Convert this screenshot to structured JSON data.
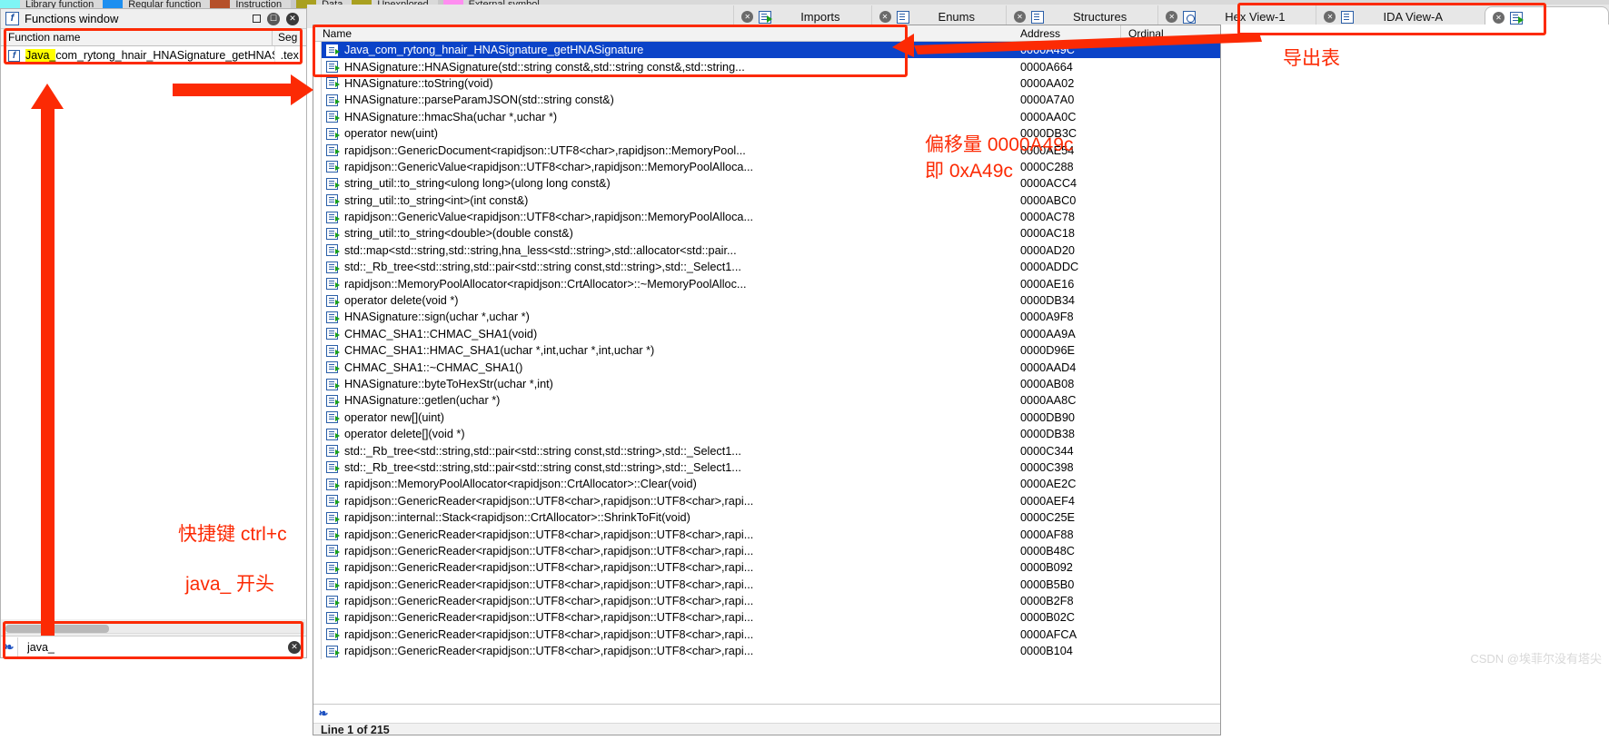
{
  "legend": {
    "entries": [
      {
        "label": "Library function",
        "color": "#7ff5f5"
      },
      {
        "label": "Regular function",
        "color": "#1d8ff0"
      },
      {
        "label": "Instruction",
        "color": "#b5502a"
      },
      {
        "label": "Data",
        "color": "#a9a020"
      },
      {
        "label": "Unexplored",
        "color": "#a9a020"
      },
      {
        "label": "External symbol",
        "color": "#ff8ef0"
      }
    ]
  },
  "functions_window": {
    "title": "Functions window",
    "icon": "function-f-icon",
    "restore_icon": "restore-icon",
    "float_icon": "float-icon",
    "close_icon": "close-icon",
    "columns": [
      "Function name",
      "Seg"
    ],
    "rows": [
      {
        "name_highlight": "Java_",
        "name_rest": "com_rytong_hnair_HNASignature_getHNASig...",
        "seg": ".tex"
      }
    ],
    "filter_value": "java_",
    "filter_placeholder": "",
    "scroll_thumb_name": "horizontal-scrollbar"
  },
  "tabs": [
    {
      "label": "IDA View-A",
      "icon": "ida-view-icon",
      "closeable": true,
      "active": false
    },
    {
      "label": "Hex View-1",
      "icon": "hex-view-icon",
      "closeable": true,
      "active": false
    },
    {
      "label": "Structures",
      "icon": "structures-icon",
      "closeable": true,
      "active": false
    },
    {
      "label": "Enums",
      "icon": "enums-icon",
      "closeable": true,
      "active": false
    },
    {
      "label": "Imports",
      "icon": "imports-icon",
      "closeable": true,
      "active": false
    },
    {
      "label": "",
      "icon": "exports-icon",
      "closeable": true,
      "active": true
    }
  ],
  "exports": {
    "columns": [
      "Name",
      "Address",
      "Ordinal"
    ],
    "status": "Line 1 of 215",
    "filter_value": "",
    "rows": [
      {
        "name": "Java_com_rytong_hnair_HNASignature_getHNASignature",
        "address": "0000A49C",
        "ordinal": "",
        "selected": true
      },
      {
        "name": "HNASignature::HNASignature(std::string const&,std::string const&,std::string...",
        "address": "0000A664",
        "ordinal": "",
        "selected": false
      },
      {
        "name": "HNASignature::toString(void)",
        "address": "0000AA02",
        "ordinal": "",
        "selected": false
      },
      {
        "name": "HNASignature::parseParamJSON(std::string const&)",
        "address": "0000A7A0",
        "ordinal": "",
        "selected": false
      },
      {
        "name": "HNASignature::hmacSha(uchar *,uchar *)",
        "address": "0000AA0C",
        "ordinal": "",
        "selected": false
      },
      {
        "name": "operator new(uint)",
        "address": "0000DB3C",
        "ordinal": "",
        "selected": false
      },
      {
        "name": "rapidjson::GenericDocument<rapidjson::UTF8<char>,rapidjson::MemoryPool...",
        "address": "0000AE54",
        "ordinal": "",
        "selected": false
      },
      {
        "name": "rapidjson::GenericValue<rapidjson::UTF8<char>,rapidjson::MemoryPoolAlloca...",
        "address": "0000C288",
        "ordinal": "",
        "selected": false
      },
      {
        "name": "string_util::to_string<ulong long>(ulong long const&)",
        "address": "0000ACC4",
        "ordinal": "",
        "selected": false
      },
      {
        "name": "string_util::to_string<int>(int const&)",
        "address": "0000ABC0",
        "ordinal": "",
        "selected": false
      },
      {
        "name": "rapidjson::GenericValue<rapidjson::UTF8<char>,rapidjson::MemoryPoolAlloca...",
        "address": "0000AC78",
        "ordinal": "",
        "selected": false
      },
      {
        "name": "string_util::to_string<double>(double const&)",
        "address": "0000AC18",
        "ordinal": "",
        "selected": false
      },
      {
        "name": "std::map<std::string,std::string,hna_less<std::string>,std::allocator<std::pair...",
        "address": "0000AD20",
        "ordinal": "",
        "selected": false
      },
      {
        "name": "std::_Rb_tree<std::string,std::pair<std::string const,std::string>,std::_Select1...",
        "address": "0000ADDC",
        "ordinal": "",
        "selected": false
      },
      {
        "name": "rapidjson::MemoryPoolAllocator<rapidjson::CrtAllocator>::~MemoryPoolAlloc...",
        "address": "0000AE16",
        "ordinal": "",
        "selected": false
      },
      {
        "name": "operator delete(void *)",
        "address": "0000DB34",
        "ordinal": "",
        "selected": false
      },
      {
        "name": "HNASignature::sign(uchar *,uchar *)",
        "address": "0000A9F8",
        "ordinal": "",
        "selected": false
      },
      {
        "name": "CHMAC_SHA1::CHMAC_SHA1(void)",
        "address": "0000AA9A",
        "ordinal": "",
        "selected": false
      },
      {
        "name": "CHMAC_SHA1::HMAC_SHA1(uchar *,int,uchar *,int,uchar *)",
        "address": "0000D96E",
        "ordinal": "",
        "selected": false
      },
      {
        "name": "CHMAC_SHA1::~CHMAC_SHA1()",
        "address": "0000AAD4",
        "ordinal": "",
        "selected": false
      },
      {
        "name": "HNASignature::byteToHexStr(uchar *,int)",
        "address": "0000AB08",
        "ordinal": "",
        "selected": false
      },
      {
        "name": "HNASignature::getlen(uchar *)",
        "address": "0000AA8C",
        "ordinal": "",
        "selected": false
      },
      {
        "name": "operator new[](uint)",
        "address": "0000DB90",
        "ordinal": "",
        "selected": false
      },
      {
        "name": "operator delete[](void *)",
        "address": "0000DB38",
        "ordinal": "",
        "selected": false
      },
      {
        "name": "std::_Rb_tree<std::string,std::pair<std::string const,std::string>,std::_Select1...",
        "address": "0000C344",
        "ordinal": "",
        "selected": false
      },
      {
        "name": "std::_Rb_tree<std::string,std::pair<std::string const,std::string>,std::_Select1...",
        "address": "0000C398",
        "ordinal": "",
        "selected": false
      },
      {
        "name": "rapidjson::MemoryPoolAllocator<rapidjson::CrtAllocator>::Clear(void)",
        "address": "0000AE2C",
        "ordinal": "",
        "selected": false
      },
      {
        "name": "rapidjson::GenericReader<rapidjson::UTF8<char>,rapidjson::UTF8<char>,rapi...",
        "address": "0000AEF4",
        "ordinal": "",
        "selected": false
      },
      {
        "name": "rapidjson::internal::Stack<rapidjson::CrtAllocator>::ShrinkToFit(void)",
        "address": "0000C25E",
        "ordinal": "",
        "selected": false
      },
      {
        "name": "rapidjson::GenericReader<rapidjson::UTF8<char>,rapidjson::UTF8<char>,rapi...",
        "address": "0000AF88",
        "ordinal": "",
        "selected": false
      },
      {
        "name": "rapidjson::GenericReader<rapidjson::UTF8<char>,rapidjson::UTF8<char>,rapi...",
        "address": "0000B48C",
        "ordinal": "",
        "selected": false
      },
      {
        "name": "rapidjson::GenericReader<rapidjson::UTF8<char>,rapidjson::UTF8<char>,rapi...",
        "address": "0000B092",
        "ordinal": "",
        "selected": false
      },
      {
        "name": "rapidjson::GenericReader<rapidjson::UTF8<char>,rapidjson::UTF8<char>,rapi...",
        "address": "0000B5B0",
        "ordinal": "",
        "selected": false
      },
      {
        "name": "rapidjson::GenericReader<rapidjson::UTF8<char>,rapidjson::UTF8<char>,rapi...",
        "address": "0000B2F8",
        "ordinal": "",
        "selected": false
      },
      {
        "name": "rapidjson::GenericReader<rapidjson::UTF8<char>,rapidjson::UTF8<char>,rapi...",
        "address": "0000B02C",
        "ordinal": "",
        "selected": false
      },
      {
        "name": "rapidjson::GenericReader<rapidjson::UTF8<char>,rapidjson::UTF8<char>,rapi...",
        "address": "0000AFCA",
        "ordinal": "",
        "selected": false
      },
      {
        "name": "rapidjson::GenericReader<rapidjson::UTF8<char>,rapidjson::UTF8<char>,rapi...",
        "address": "0000B104",
        "ordinal": "",
        "selected": false
      }
    ]
  },
  "annotations": {
    "color": "#fc2a04",
    "exports_table_label": "导出表",
    "offset_line1": "偏移量 0000A49c",
    "offset_line2": "即 0xA49c",
    "shortcut_label": "快捷键 ctrl+c",
    "prefix_label": "java_ 开头"
  },
  "watermark": "CSDN @埃菲尔没有塔尖"
}
